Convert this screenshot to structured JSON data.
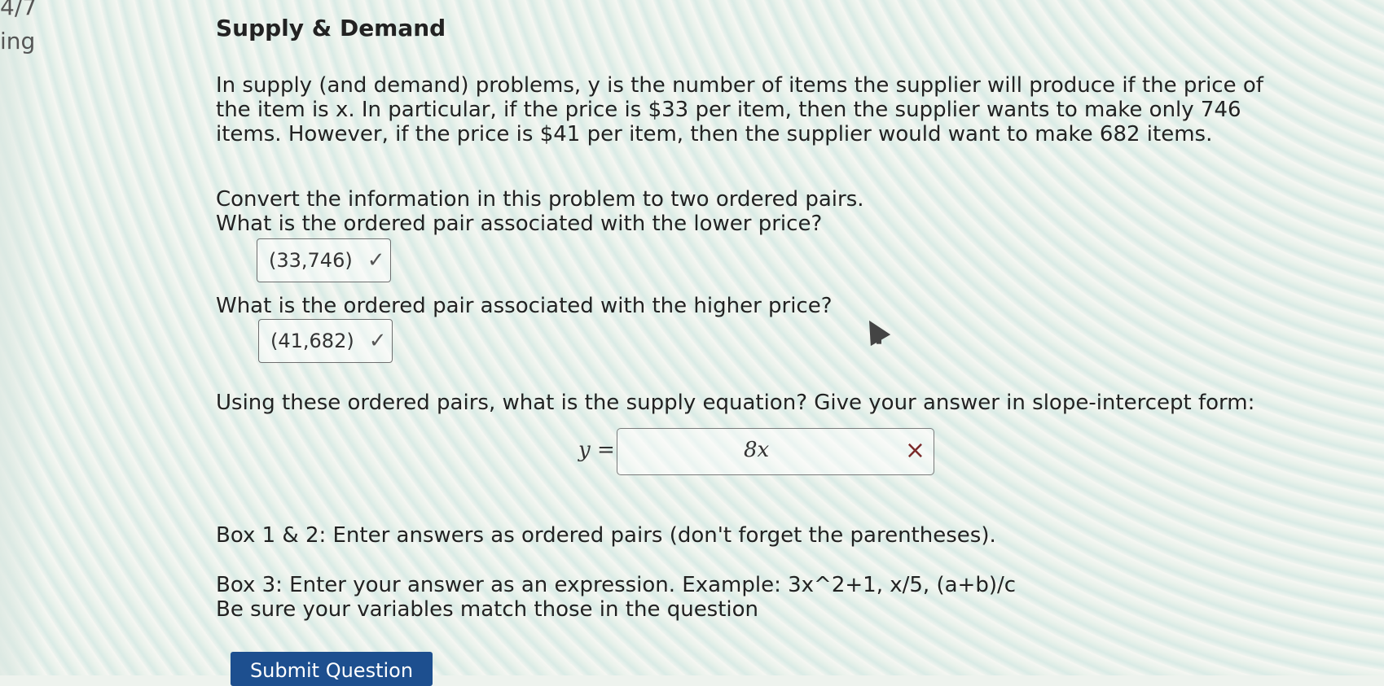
{
  "page": {
    "left_fragments": [
      "4/7",
      "ing"
    ],
    "title": "Supply & Demand",
    "paragraph_1": "In supply (and demand) problems, y is the number of items the supplier will produce if the price of the item is x. In particular, if the price is $33 per item, then the supplier wants to make only 746 items. However, if the price is $41 per item, then the supplier would want to make 682 items.",
    "paragraph_2": "Convert the information in this problem to two ordered pairs.",
    "question_1": "What is the ordered pair associated with the lower price?",
    "answer_1": "(33,746)",
    "question_2": "What is the ordered pair associated with the higher price?",
    "answer_2": "(41,682)",
    "question_3": "Using these ordered pairs, what is the supply equation? Give your answer in slope-intercept form:",
    "equation_label": "y =",
    "answer_3": "8x",
    "note_1": "Box 1 & 2: Enter answers as ordered pairs (don't forget the parentheses).",
    "note_2": "Box 3: Enter your answer as an expression. Example: 3x^2+1, x/5, (a+b)/c",
    "note_3": "Be sure your variables match those in the question",
    "submit_label": "Submit Question"
  },
  "icons": {
    "correct_1": "check-icon",
    "correct_2": "check-icon",
    "incorrect_3": "close-icon",
    "pointer": "cursor-icon"
  }
}
